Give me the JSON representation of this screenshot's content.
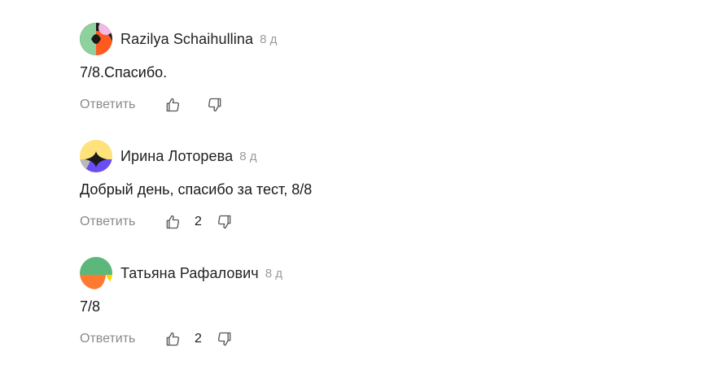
{
  "comments": [
    {
      "author": "Razilya Schaihullina",
      "time": "8 д",
      "text": "7/8.Спасибо.",
      "reply_label": "Ответить",
      "likes": "",
      "avatar_colors": [
        "#1a1a1a",
        "#f2b8e6",
        "#8fd19e",
        "#ff5a1f"
      ]
    },
    {
      "author": "Ирина Лоторева",
      "time": "8 д",
      "text": "Добрый день, спасибо за тест, 8/8",
      "reply_label": "Ответить",
      "likes": "2",
      "avatar_colors": [
        "#ffe27a",
        "#1a1a1a",
        "#6b4cf5",
        "#b9b9b9"
      ]
    },
    {
      "author": "Татьяна Рафалович",
      "time": "8 д",
      "text": "7/8",
      "reply_label": "Ответить",
      "likes": "2",
      "avatar_colors": [
        "#5cb87a",
        "#ff7a30",
        "#ffd400",
        "#ffffff"
      ]
    }
  ],
  "icons": {
    "like": "thumbs-up-icon",
    "dislike": "thumbs-down-icon"
  }
}
